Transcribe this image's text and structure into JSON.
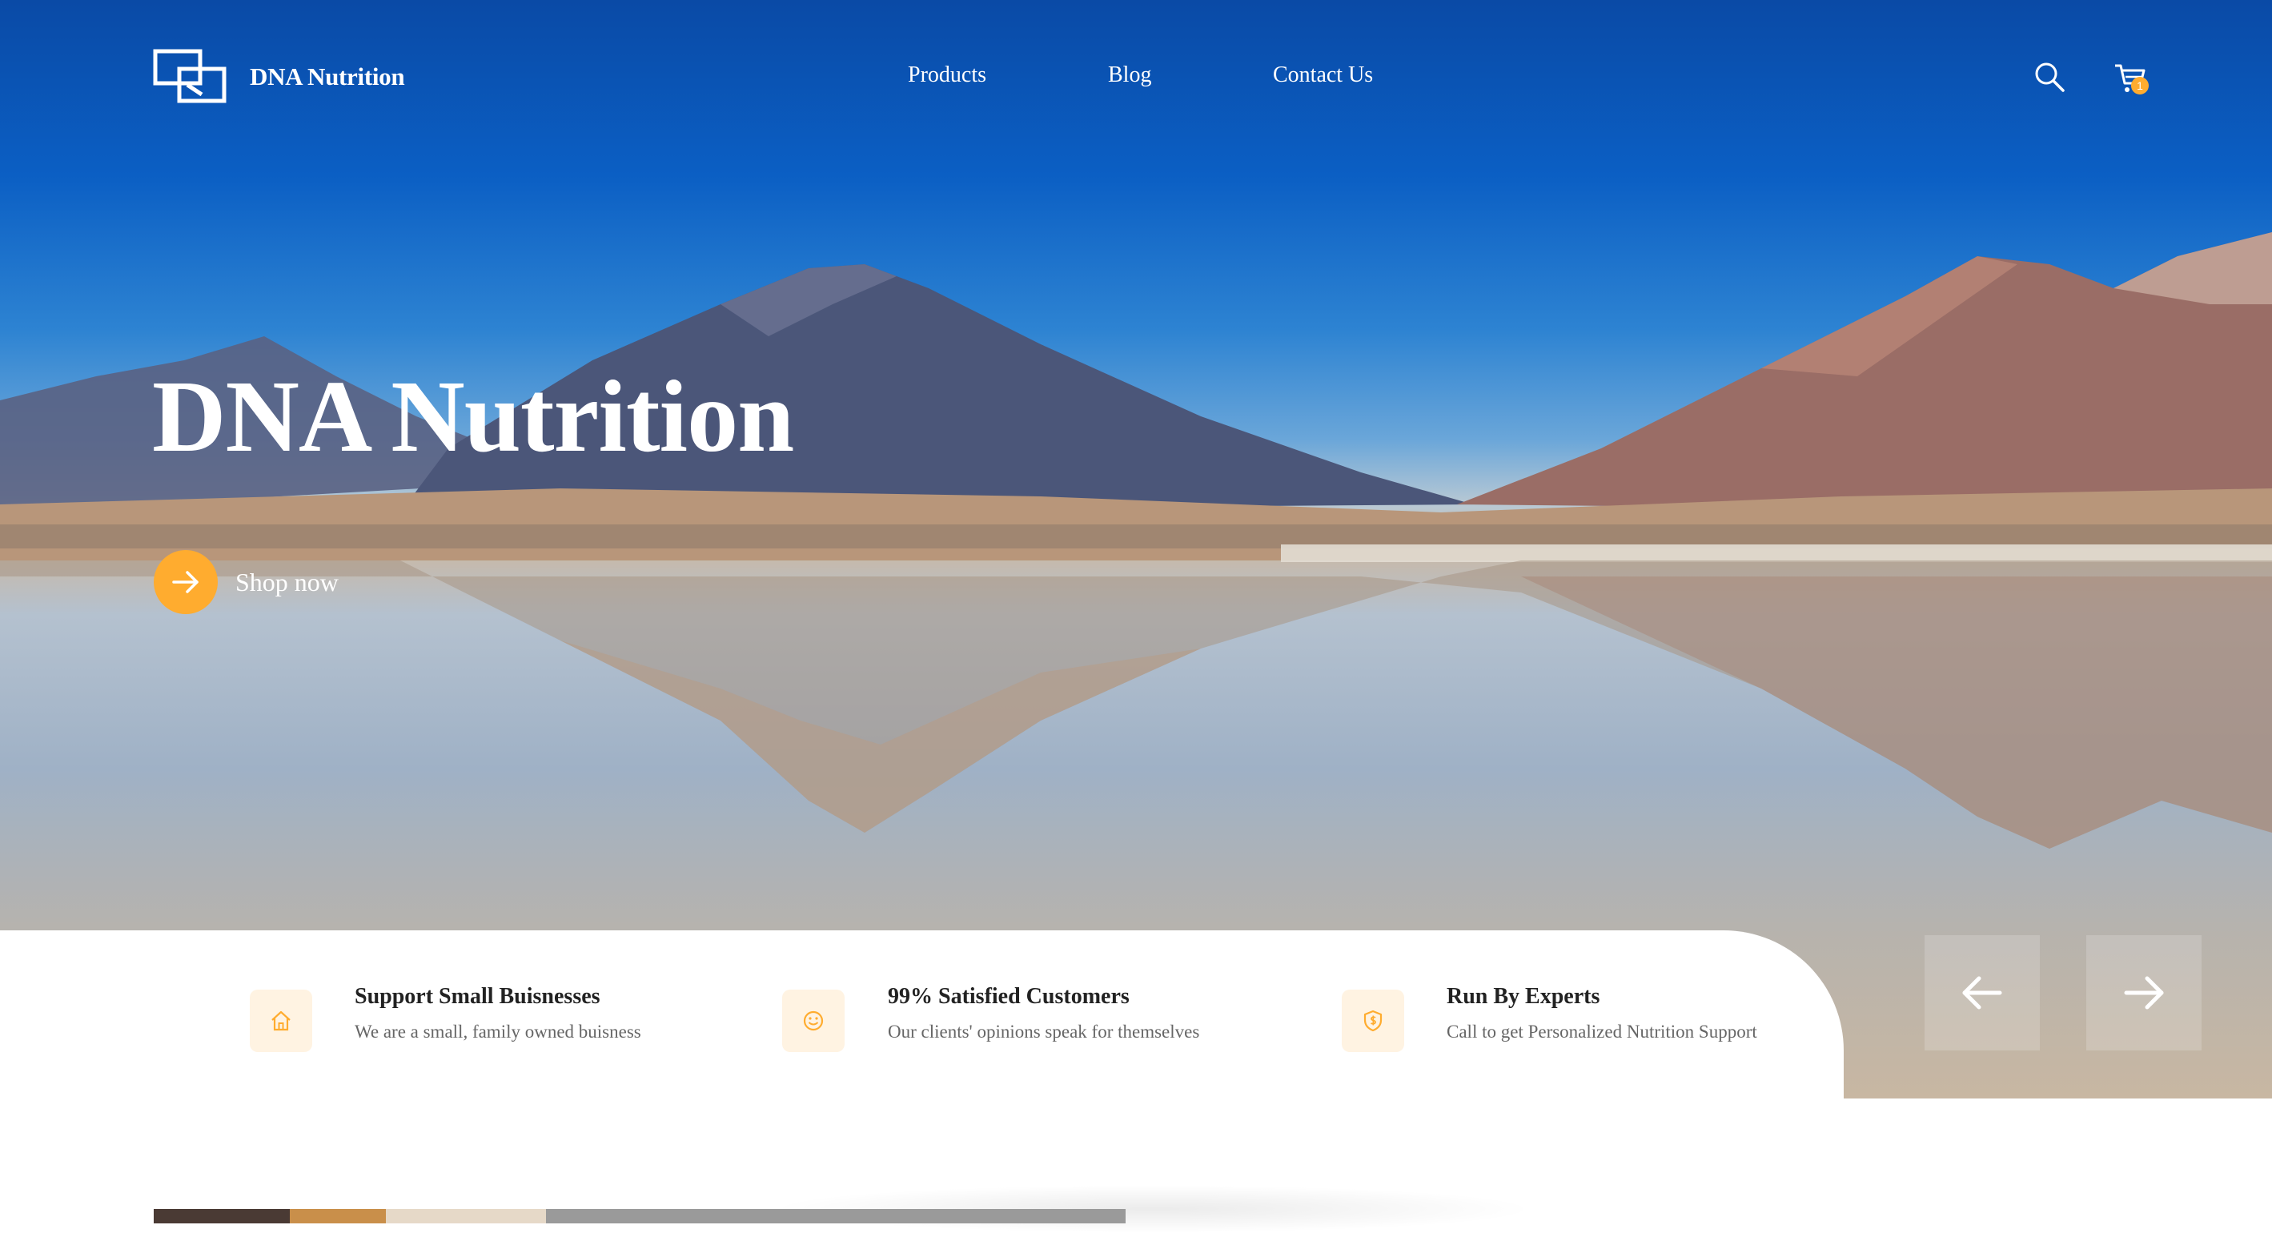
{
  "header": {
    "brand": "DNA Nutrition",
    "nav": [
      {
        "label": "Products"
      },
      {
        "label": "Blog"
      },
      {
        "label": "Contact Us"
      }
    ],
    "cart_count": "1"
  },
  "hero": {
    "title": "DNA Nutrition",
    "cta_label": "Shop now"
  },
  "features": [
    {
      "icon": "home-icon",
      "title": "Support Small Buisnesses",
      "desc": "We are a small, family owned buisness"
    },
    {
      "icon": "smile-icon",
      "title": "99% Satisfied Customers",
      "desc": "Our clients' opinions speak for themselves"
    },
    {
      "icon": "dollar-shield-icon",
      "title": "Run By Experts",
      "desc": "Call to get Personalized Nutrition Support"
    }
  ],
  "colors": {
    "accent": "#ffac2f",
    "icon_bg": "#fff3e2",
    "title_text": "#222222",
    "desc_text": "#666666"
  }
}
